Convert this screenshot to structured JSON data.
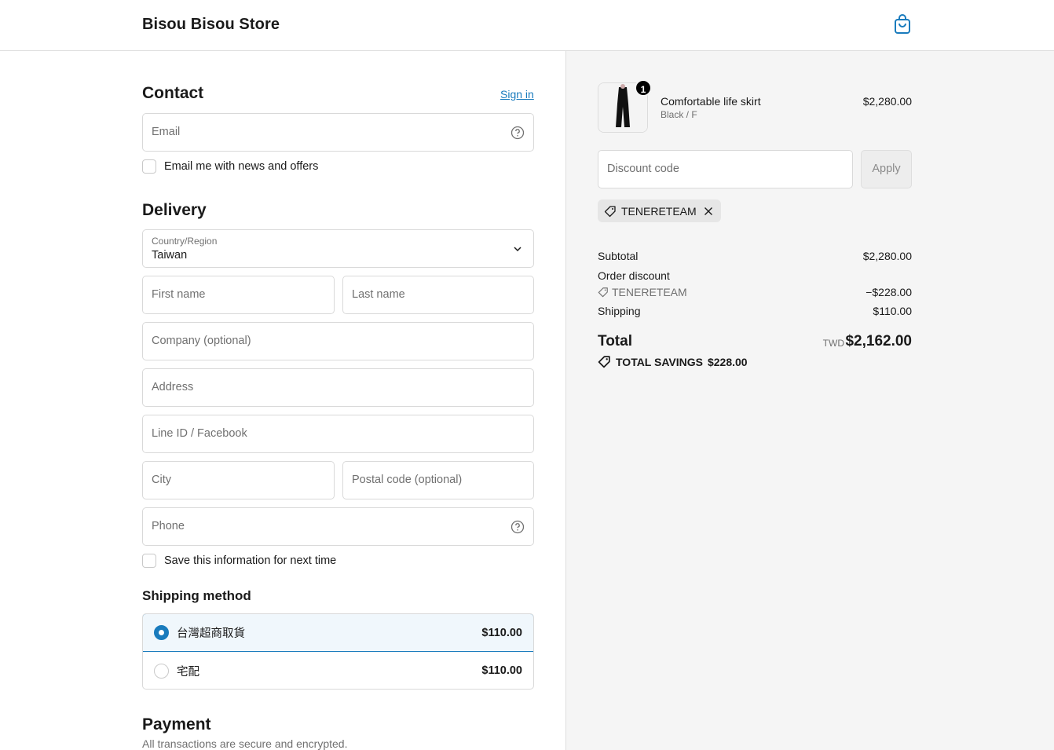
{
  "header": {
    "store_name": "Bisou Bisou Store",
    "cart_icon": "shopping-bag-icon",
    "accent_color": "#197bbd"
  },
  "contact": {
    "title": "Contact",
    "sign_in": "Sign in",
    "email_placeholder": "Email",
    "newsletter_label": "Email me with news and offers"
  },
  "delivery": {
    "title": "Delivery",
    "country_label": "Country/Region",
    "country_value": "Taiwan",
    "first_name": "First name",
    "last_name": "Last name",
    "company": "Company (optional)",
    "address": "Address",
    "line_id": "Line ID / Facebook",
    "city": "City",
    "postal": "Postal code (optional)",
    "phone": "Phone",
    "save_info_label": "Save this information for next time"
  },
  "shipping": {
    "title": "Shipping method",
    "options": [
      {
        "label": "台灣超商取貨",
        "price": "$110.00",
        "selected": true
      },
      {
        "label": "宅配",
        "price": "$110.00",
        "selected": false
      }
    ]
  },
  "payment": {
    "title": "Payment",
    "subtitle": "All transactions are secure and encrypted."
  },
  "summary": {
    "product": {
      "name": "Comfortable life skirt",
      "variant": "Black / F",
      "price": "$2,280.00",
      "quantity": "1"
    },
    "discount_placeholder": "Discount code",
    "apply_label": "Apply",
    "applied_code": "TENERETEAM",
    "subtotal_label": "Subtotal",
    "subtotal_value": "$2,280.00",
    "order_discount_label": "Order discount",
    "order_discount_code": "TENERETEAM",
    "order_discount_value": "−$228.00",
    "shipping_label": "Shipping",
    "shipping_value": "$110.00",
    "total_label": "Total",
    "total_currency": "TWD",
    "total_value": "$2,162.00",
    "savings_label": "TOTAL SAVINGS",
    "savings_value": "$228.00"
  }
}
